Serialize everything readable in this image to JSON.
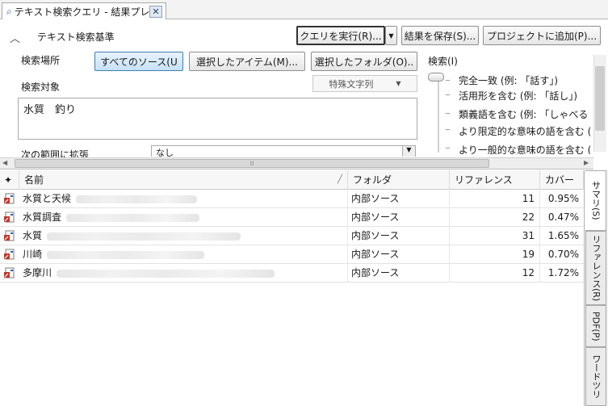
{
  "tab": {
    "title": "テキスト検索クエリ - 結果プレビ",
    "close": "✕"
  },
  "criteria": {
    "section_title": "テキスト検索基準",
    "collapse_glyph": "︿",
    "run_query": "クエリを実行(R)...",
    "save_results": "結果を保存(S)...",
    "add_to_project": "プロジェクトに追加(P)...",
    "search_location_label": "検索場所",
    "all_sources": "すべてのソース(U",
    "selected_items": "選択したアイテム(M)...",
    "selected_folders": "選択したフォルダ(O)..",
    "search_target_label": "検索対象",
    "special_chars": "特殊文字列",
    "query_text": "水質　釣り",
    "extend_range_label": "次の範囲に拡張",
    "extend_range_value": "なし",
    "search_mode_label": "検索(I)",
    "options": [
      "完全一致 (例: 「話す」)",
      "活用形を含む (例: 「話し」)",
      "類義語を含む (例: 「しゃべる",
      "より限定的な意味の語を含む (",
      "より一般的な意味の語を含む ("
    ]
  },
  "table": {
    "headers": {
      "name": "名前",
      "folder": "フォルダ",
      "references": "リファレンス",
      "coverage": "カバー"
    },
    "rows": [
      {
        "name": "水質と天候",
        "folder": "内部ソース",
        "references": "11",
        "coverage": "0.95%"
      },
      {
        "name": "水質調査",
        "folder": "内部ソース",
        "references": "22",
        "coverage": "0.47%"
      },
      {
        "name": "水質",
        "folder": "内部ソース",
        "references": "31",
        "coverage": "1.65%"
      },
      {
        "name": "川崎",
        "folder": "内部ソース",
        "references": "19",
        "coverage": "0.70%"
      },
      {
        "name": "多摩川",
        "folder": "内部ソース",
        "references": "12",
        "coverage": "1.72%"
      }
    ]
  },
  "side_tabs": [
    "サマリ(S)",
    "リファレンス(R)",
    "PDF(P)",
    "ワードツリ"
  ],
  "colors": {
    "accent": "#3c7fb1",
    "icon_red": "#c0392b",
    "icon_blue": "#2b5ea8"
  }
}
